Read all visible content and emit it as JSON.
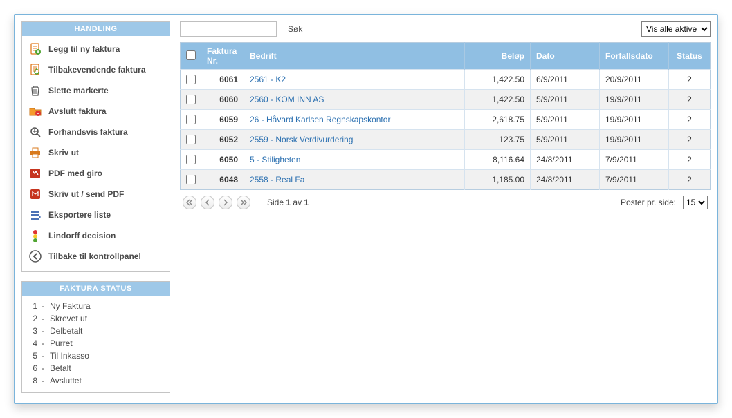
{
  "sidebar": {
    "handling_header": "HANDLING",
    "status_header": "FAKTURA STATUS",
    "actions": [
      {
        "label": "Legg til ny faktura",
        "icon_name": "add-invoice-icon"
      },
      {
        "label": "Tilbakevendende faktura",
        "icon_name": "recurring-invoice-icon"
      },
      {
        "label": "Slette markerte",
        "icon_name": "delete-icon"
      },
      {
        "label": "Avslutt faktura",
        "icon_name": "close-folder-icon"
      },
      {
        "label": "Forhandsvis faktura",
        "icon_name": "preview-icon"
      },
      {
        "label": "Skriv ut",
        "icon_name": "print-icon"
      },
      {
        "label": "PDF med giro",
        "icon_name": "pdf-icon"
      },
      {
        "label": "Skriv ut / send PDF",
        "icon_name": "pdf-send-icon"
      },
      {
        "label": "Eksportere liste",
        "icon_name": "export-icon"
      },
      {
        "label": "Lindorff decision",
        "icon_name": "decision-icon"
      },
      {
        "label": "Tilbake til kontrollpanel",
        "icon_name": "back-icon"
      }
    ],
    "statuses": [
      {
        "code": "1",
        "label": "Ny Faktura"
      },
      {
        "code": "2",
        "label": "Skrevet ut"
      },
      {
        "code": "3",
        "label": "Delbetalt"
      },
      {
        "code": "4",
        "label": "Purret"
      },
      {
        "code": "5",
        "label": "Til Inkasso"
      },
      {
        "code": "6",
        "label": "Betalt"
      },
      {
        "code": "8",
        "label": "Avsluttet"
      }
    ]
  },
  "toolbar": {
    "search_button": "Søk",
    "filter_selected": "Vis alle aktive"
  },
  "table": {
    "columns": {
      "nr": "Faktura Nr.",
      "bedrift": "Bedrift",
      "belop": "Beløp",
      "dato": "Dato",
      "forfall": "Forfallsdato",
      "status": "Status"
    },
    "rows": [
      {
        "nr": "6061",
        "bedrift": "2561 - K2",
        "belop": "1,422.50",
        "dato": "6/9/2011",
        "forfall": "20/9/2011",
        "status": "2"
      },
      {
        "nr": "6060",
        "bedrift": "2560 - KOM INN AS",
        "belop": "1,422.50",
        "dato": "5/9/2011",
        "forfall": "19/9/2011",
        "status": "2"
      },
      {
        "nr": "6059",
        "bedrift": "26 - Håvard Karlsen Regnskapskontor",
        "belop": "2,618.75",
        "dato": "5/9/2011",
        "forfall": "19/9/2011",
        "status": "2"
      },
      {
        "nr": "6052",
        "bedrift": "2559 - Norsk Verdivurdering",
        "belop": "123.75",
        "dato": "5/9/2011",
        "forfall": "19/9/2011",
        "status": "2"
      },
      {
        "nr": "6050",
        "bedrift": "5 - Stiligheten",
        "belop": "8,116.64",
        "dato": "24/8/2011",
        "forfall": "7/9/2011",
        "status": "2"
      },
      {
        "nr": "6048",
        "bedrift": "2558 - Real Fa",
        "belop": "1,185.00",
        "dato": "24/8/2011",
        "forfall": "7/9/2011",
        "status": "2"
      }
    ]
  },
  "pager": {
    "side_label": "Side",
    "page_current": "1",
    "av_label": "av",
    "page_total": "1",
    "per_page_label": "Poster pr. side:",
    "per_page_value": "15"
  }
}
